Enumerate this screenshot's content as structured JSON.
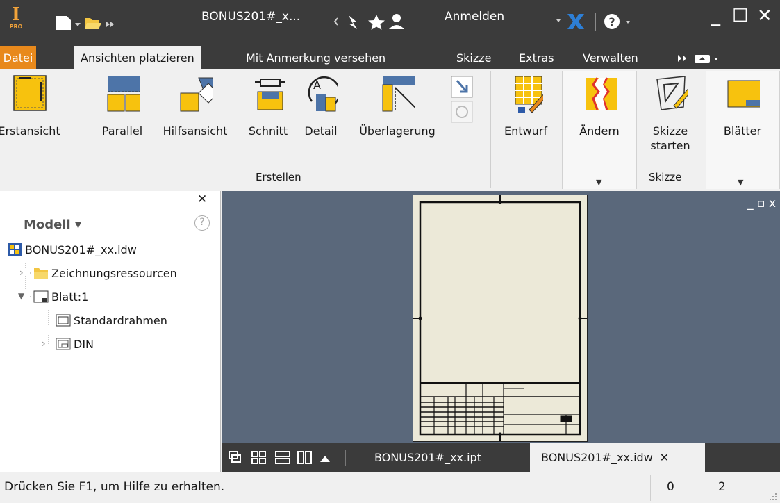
{
  "titlebar": {
    "logo_letter": "I",
    "logo_sub": "PRO",
    "document_title": "BONUS201#_x...",
    "signin_label": "Anmelden",
    "minimize_glyph": "_",
    "maximize_glyph": "☐",
    "close_glyph": "✕"
  },
  "tabs": {
    "file": "Datei",
    "items": [
      "Ansichten platzieren",
      "Mit Anmerkung versehen",
      "Skizze",
      "Extras",
      "Verwalten"
    ],
    "active_index": 0
  },
  "ribbon": {
    "create_buttons": [
      "Erstansicht",
      "Parallel",
      "Hilfsansicht",
      "Schnitt",
      "Detail",
      "Überlagerung"
    ],
    "draft_label": "Entwurf",
    "create_panel_label": "Erstellen",
    "modify_label": "Ändern",
    "sketch_start_label": "Skizze\nstarten",
    "sketch_panel_label": "Skizze",
    "sheets_label": "Blätter"
  },
  "browser": {
    "title": "Modell ▾",
    "help_glyph": "?",
    "close_glyph": "✕",
    "tree": [
      {
        "label": "BONUS201#_xx.idw",
        "icon": "drawing-file-icon"
      },
      {
        "label": "Zeichnungsressourcen",
        "icon": "folder-icon"
      },
      {
        "label": "Blatt:1",
        "icon": "sheet-icon"
      },
      {
        "label": "Standardrahmen",
        "icon": "frame-icon"
      },
      {
        "label": "DIN",
        "icon": "title-block-icon"
      }
    ]
  },
  "canvas": {
    "window_buttons": "_ ▫ x"
  },
  "docbar": {
    "tabs": [
      "BONUS201#_xx.ipt",
      "BONUS201#_xx.idw"
    ],
    "active_index": 1,
    "close_glyph": "✕"
  },
  "statusbar": {
    "help_text": "Drücken Sie F1, um Hilfe zu erhalten.",
    "count_1": "0",
    "count_2": "2"
  },
  "colors": {
    "dark_chrome": "#3b3b3b",
    "file_tab": "#e8891c",
    "canvas_bg": "#5a687b",
    "sheet_bg": "#ece9d8",
    "icon_yellow": "#f7c20e",
    "icon_blue": "#4d74a8"
  }
}
